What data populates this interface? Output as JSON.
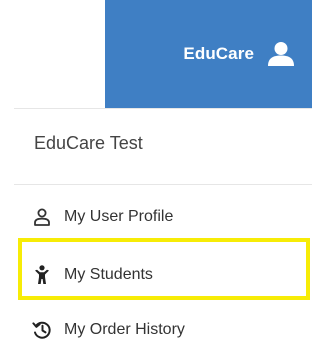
{
  "header": {
    "brand": "EduCare",
    "avatar_icon": "user-icon",
    "background_color": "#3f7fc4"
  },
  "dropdown": {
    "account_name": "EduCare Test",
    "items": [
      {
        "label": "My User Profile",
        "icon": "user-outline-icon"
      },
      {
        "label": "My Students",
        "icon": "child-icon"
      },
      {
        "label": "My Order History",
        "icon": "history-icon"
      }
    ]
  },
  "highlight": {
    "target": "My Students",
    "color": "#f7ec06"
  }
}
